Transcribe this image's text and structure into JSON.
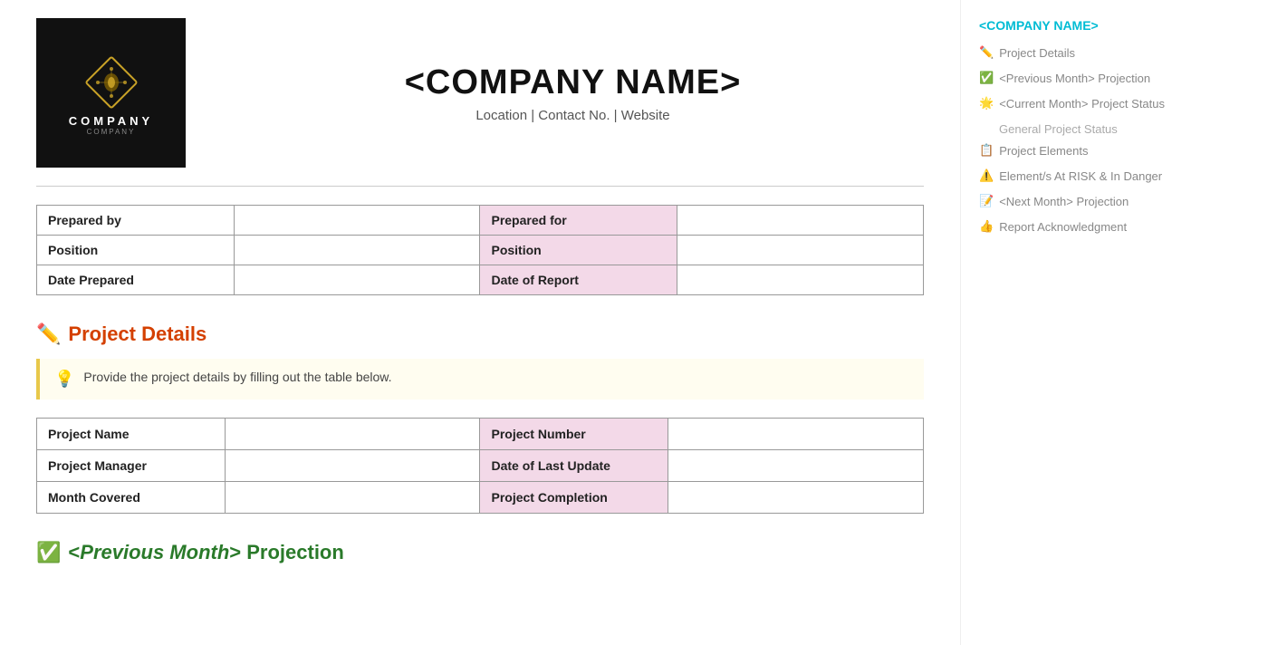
{
  "header": {
    "company_name": "<COMPANY NAME>",
    "company_info": "Location | Contact No. | Website",
    "logo_text": "COMPANY",
    "logo_sub": "COMPANY"
  },
  "cover_table": {
    "rows": [
      [
        {
          "text": "Prepared by",
          "type": "label"
        },
        {
          "text": "",
          "type": "value"
        },
        {
          "text": "Prepared for",
          "type": "label-pink"
        },
        {
          "text": "",
          "type": "value"
        }
      ],
      [
        {
          "text": "Position",
          "type": "label"
        },
        {
          "text": "",
          "type": "value"
        },
        {
          "text": "Position",
          "type": "label-pink"
        },
        {
          "text": "",
          "type": "value"
        }
      ],
      [
        {
          "text": "Date Prepared",
          "type": "label"
        },
        {
          "text": "",
          "type": "value"
        },
        {
          "text": "Date of Report",
          "type": "label-pink"
        },
        {
          "text": "",
          "type": "value"
        }
      ]
    ]
  },
  "project_details_section": {
    "emoji": "✏️",
    "heading": "Project Details",
    "tip_emoji": "💡",
    "tip_text": "Provide the project details by filling out the table below.",
    "table": {
      "rows": [
        [
          {
            "text": "Project Name",
            "type": "label"
          },
          {
            "text": "",
            "type": "value"
          },
          {
            "text": "Project Number",
            "type": "label-pink"
          },
          {
            "text": "",
            "type": "value"
          }
        ],
        [
          {
            "text": "Project Manager",
            "type": "label"
          },
          {
            "text": "",
            "type": "value"
          },
          {
            "text": "Date of Last Update",
            "type": "label-pink"
          },
          {
            "text": "",
            "type": "value"
          }
        ],
        [
          {
            "text": "Month Covered",
            "type": "label"
          },
          {
            "text": "",
            "type": "value"
          },
          {
            "text": "Project Completion",
            "type": "label-pink"
          },
          {
            "text": "",
            "type": "value"
          }
        ]
      ]
    }
  },
  "prev_month_section": {
    "emoji": "✅",
    "heading_prefix": "<",
    "heading_italic": "Previous Month",
    "heading_suffix": "> Projection"
  },
  "sidebar": {
    "company_name": "<COMPANY NAME>",
    "items": [
      {
        "emoji": "✏️",
        "label": "Project Details"
      },
      {
        "emoji": "✅",
        "label": "<Previous Month> Projection"
      },
      {
        "emoji": "🌟",
        "label": "<Current Month> Project Status"
      },
      {
        "emoji": "",
        "label": "General Project Status",
        "is_sub": true
      },
      {
        "emoji": "📋",
        "label": "Project Elements"
      },
      {
        "emoji": "⚠️",
        "label": "Element/s At RISK & In Danger"
      },
      {
        "emoji": "📝",
        "label": "<Next Month> Projection"
      },
      {
        "emoji": "👍",
        "label": "Report Acknowledgment"
      }
    ]
  }
}
